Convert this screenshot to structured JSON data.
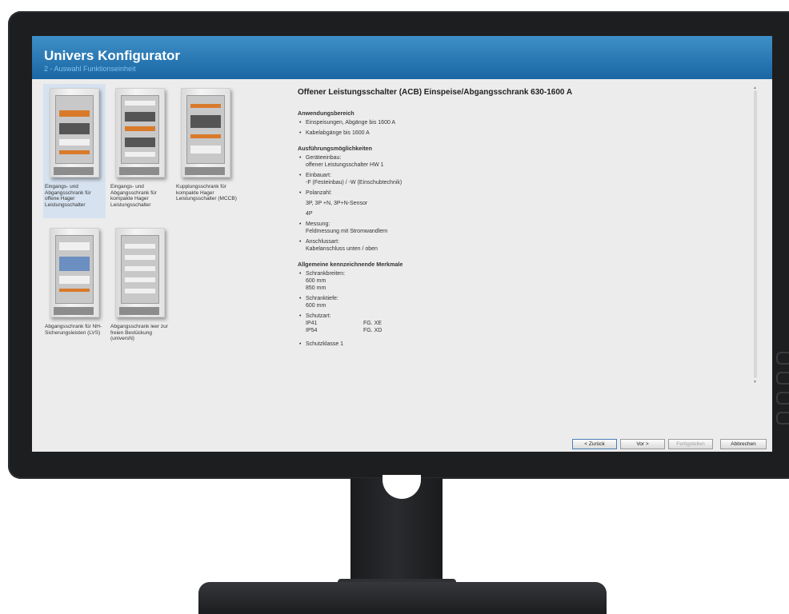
{
  "app": {
    "title": "Univers Konfigurator",
    "subtitle": "2 - Auswahl Funktionseinheit"
  },
  "tiles": [
    {
      "label": "Eingangs- und Abgangsschrank für offene Hager Leistungsschalter",
      "selected": true
    },
    {
      "label": "Eingangs- und Abgangsschrank für kompakte Hager Leistungsschalter",
      "selected": false
    },
    {
      "label": "Kupplungsschrank für kompakte Hager Leistungsschalter (MCCB)",
      "selected": false
    },
    {
      "label": "Abgangsschrank für NH-Sicherungsleisten (LVS)",
      "selected": false
    },
    {
      "label": "Abgangsschrank leer zur freien Bestückung (universN)",
      "selected": false
    }
  ],
  "detail": {
    "heading": "Offener Leistungsschalter (ACB) Einspeise/Abgangsschrank 630-1600 A",
    "sections": {
      "anwendung": {
        "title": "Anwendungsbereich",
        "items": [
          "Einspeisungen, Abgänge bis 1600 A",
          "Kabelabgänge bis 1600 A"
        ]
      },
      "ausfuehrung": {
        "title": "Ausführungsmöglichkeiten",
        "geraeteeinbau": "Geräteeinbau:",
        "geraeteeinbau_val": "offener Leistungsschalter HW 1",
        "einbauart": "Einbauart:",
        "einbauart_val": "-F (Festeinbau) / -W (Einschubtechnik)",
        "polanzahl": "Polanzahl:",
        "polanzahl_val1": "3P, 3P +N, 3P+N-Sensor",
        "polanzahl_val2": "4P",
        "messung": "Messung:",
        "messung_val": "Feldmessung mit Stromwandlern",
        "anschluss": "Anschlussart:",
        "anschluss_val": "Kabelanschluss unten / oben"
      },
      "merkmale": {
        "title": "Allgemeine kennzeichnende Merkmale",
        "breiten": "Schrankbreiten:",
        "breite1": "600 mm",
        "breite2": "850 mm",
        "tiefe": "Schranktiefe:",
        "tiefe_val": "600 mm",
        "schutzart": "Schutzart:",
        "ip1": "IP41",
        "fg1": "FG. XE",
        "ip2": "IP54",
        "fg2": "FG. XD",
        "schutzklasse": "Schutzklasse 1"
      }
    }
  },
  "buttons": {
    "back": "< Zurück",
    "next": "Vor >",
    "finish": "Fertigstellen",
    "cancel": "Abbrechen"
  },
  "colors": {
    "titlebar": "#1a66a3",
    "subtitle": "#7fc2ef",
    "selected_tile": "#d6e2ef",
    "accent_component": "#d97a2b"
  }
}
